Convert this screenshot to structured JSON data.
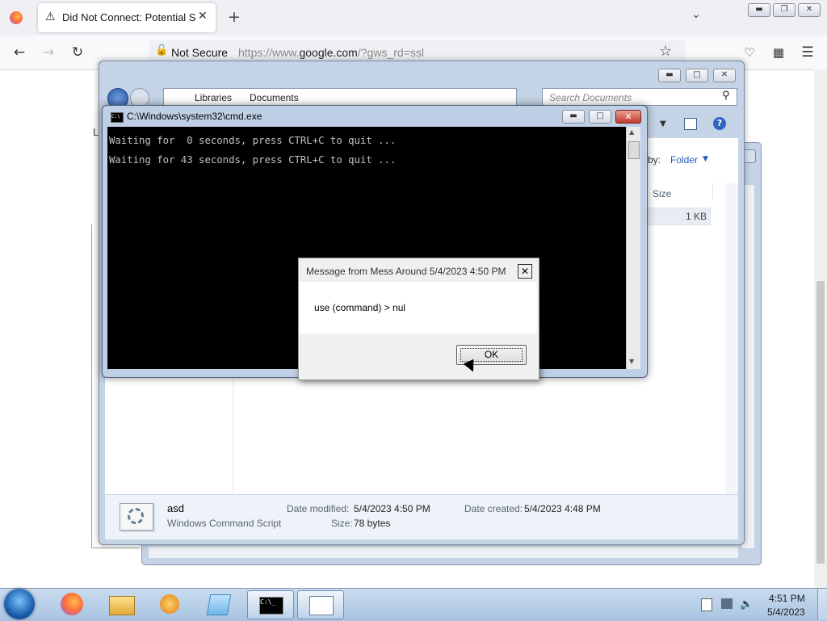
{
  "browser": {
    "tab_title": "Did Not Connect: Potential Security Issue",
    "new_tab": "+",
    "not_secure": "Not Secure",
    "url_prefix": "https://www.",
    "url_domain": "google.com",
    "url_path": "/?gws_rd=ssl"
  },
  "explorer": {
    "breadcrumb": [
      "Libraries",
      "Documents"
    ],
    "search_placeholder": "Search Documents",
    "arrange_by_label": "by:",
    "arrange_value": "Folder",
    "column_size": "Size",
    "row_size": "1 KB",
    "partial_letter": "L",
    "details": {
      "name": "asd",
      "type": "Windows Command Script",
      "date_modified_label": "Date modified:",
      "date_modified": "5/4/2023 4:50 PM",
      "size_label": "Size:",
      "size": "78 bytes",
      "date_created_label": "Date created:",
      "date_created": "5/4/2023 4:48 PM"
    }
  },
  "cmd": {
    "title": "C:\\Windows\\system32\\cmd.exe",
    "lines": [
      "Waiting for  0 seconds, press CTRL+C to quit ...",
      "Waiting for 43 seconds, press CTRL+C to quit ..."
    ]
  },
  "msgbox": {
    "title": "Message from Mess Around 5/4/2023 4:50 PM",
    "message": "use (command) > nul",
    "ok_label": "OK"
  },
  "taskbar": {
    "time": "4:51 PM",
    "date": "5/4/2023"
  },
  "icons": {
    "firefox": "firefox-icon",
    "warning": "warning-icon",
    "close": "close-icon",
    "back": "back-arrow-icon",
    "forward": "forward-arrow-icon",
    "reload": "reload-icon",
    "bookmark": "star-icon",
    "pocket": "pocket-icon",
    "extensions": "puzzle-icon",
    "menu": "hamburger-menu-icon"
  }
}
